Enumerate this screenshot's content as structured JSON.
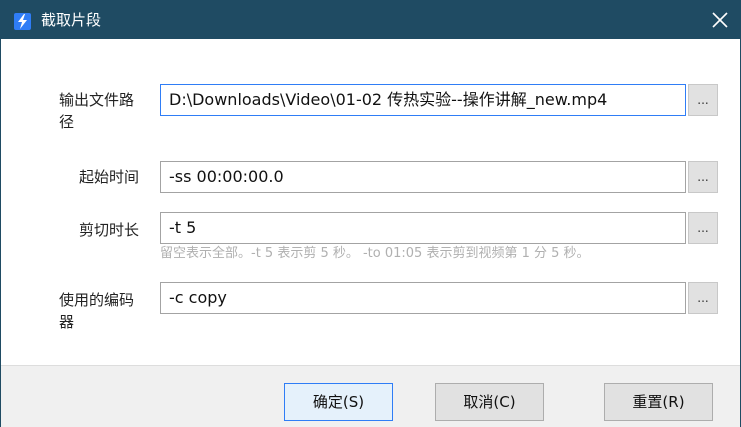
{
  "window": {
    "title": "截取片段",
    "close_label": "×"
  },
  "form": {
    "output_path": {
      "label_line1": "输出文件路",
      "label_line2": "径",
      "value": "D:\\Downloads\\Video\\01-02  传热实验--操作讲解_new.mp4",
      "browse_label": "..."
    },
    "start_time": {
      "label": "起始时间",
      "value": "-ss 00:00:00.0",
      "browse_label": "..."
    },
    "duration": {
      "label": "剪切时长",
      "value": "-t 5",
      "browse_label": "...",
      "hint": "留空表示全部。-t 5 表示剪 5 秒。 -to 01:05 表示剪到视频第 1 分 5 秒。"
    },
    "encoder": {
      "label_line1": "使用的编码",
      "label_line2": "器",
      "value": "-c copy",
      "browse_label": "..."
    }
  },
  "buttons": {
    "ok": "确定(S)",
    "cancel": "取消(C)",
    "reset": "重置(R)"
  },
  "colors": {
    "titlebar": "#1f4b63",
    "accent": "#2f7df6",
    "hint_text": "#b0b0b0"
  }
}
